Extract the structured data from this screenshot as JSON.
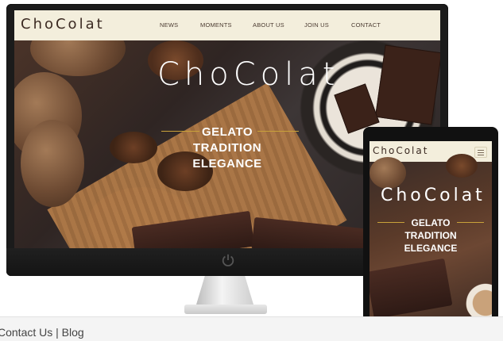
{
  "desktop": {
    "brand": "ChoColat",
    "nav": [
      "NEWS",
      "MOMENTS",
      "ABOUT US",
      "JOIN US",
      "CONTACT"
    ],
    "hero": {
      "logo": "ChoColat",
      "lines": [
        "GELATO",
        "TRADITION",
        "ELEGANCE"
      ]
    }
  },
  "mobile": {
    "brand": "ChoColat",
    "hero": {
      "logo": "ChoColat",
      "lines": [
        "GELATO",
        "TRADITION",
        "ELEGANCE"
      ]
    }
  },
  "footer": {
    "links": [
      "Contact Us",
      "Blog"
    ],
    "separator": "|"
  },
  "colors": {
    "nav_bg": "#f3eedc",
    "brand_text": "#3b2a22",
    "gold_accent": "#c9a23a",
    "hero_text": "#ffffff",
    "device_frame": "#1b1b1b"
  },
  "icons": {
    "power": "power-icon",
    "menu": "hamburger-menu-icon"
  }
}
